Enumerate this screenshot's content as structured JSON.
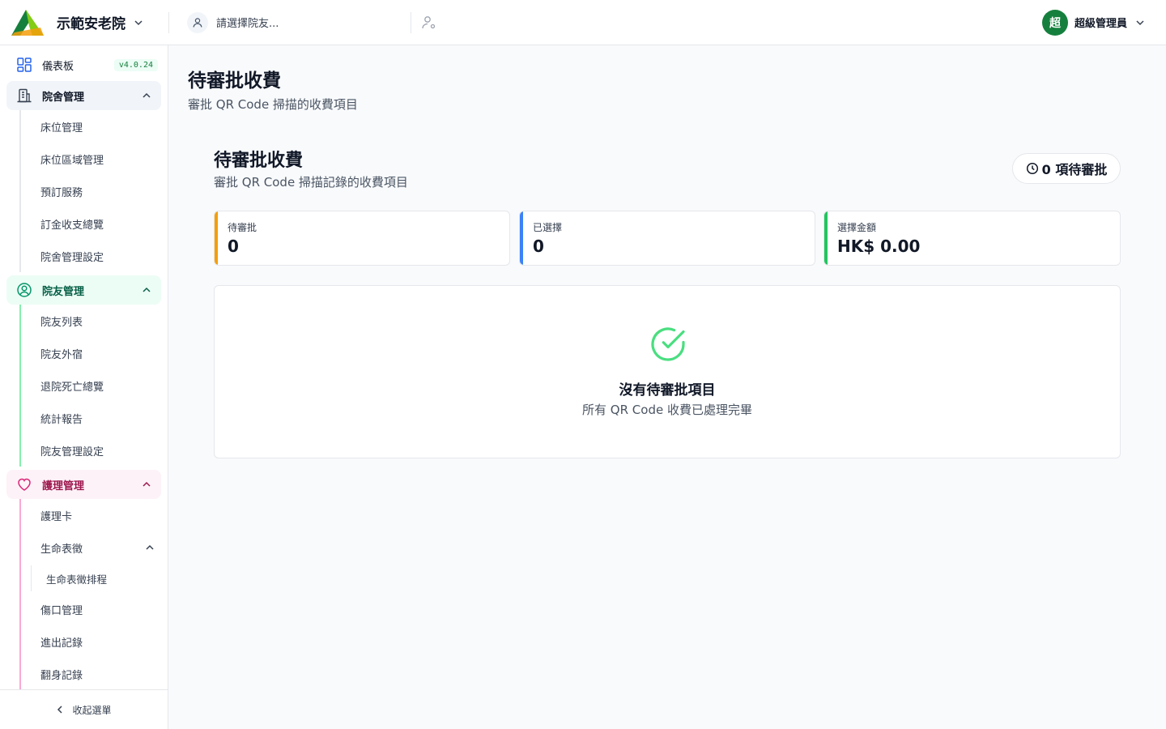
{
  "app": {
    "facility_name": "示範安老院",
    "resident_placeholder": "請選擇院友...",
    "user_initial": "超",
    "user_name": "超級管理員",
    "accent": "#15803d"
  },
  "sidebar": {
    "dashboard": {
      "label": "儀表板",
      "version": "v4.0.24",
      "icon": "dashboard-grid-icon"
    },
    "groups": [
      {
        "label": "院舍管理",
        "icon": "building-icon",
        "items": [
          "床位管理",
          "床位區域管理",
          "預訂服務",
          "訂金收支總覽",
          "院舍管理設定"
        ]
      },
      {
        "label": "院友管理",
        "icon": "user-circle-icon",
        "items": [
          "院友列表",
          "院友外宿",
          "退院死亡總覽",
          "統計報告",
          "院友管理設定"
        ]
      },
      {
        "label": "護理管理",
        "icon": "heart-icon",
        "items": [
          "護理卡",
          "生命表徵",
          "傷口管理",
          "進出記錄",
          "翻身記錄"
        ],
        "nested": {
          "parent": "生命表徵",
          "items": [
            "生命表徵排程"
          ]
        }
      }
    ],
    "collapse_label": "收起選單"
  },
  "main": {
    "page_title": "待審批收費",
    "page_subtitle": "審批 QR Code 掃描的收費項目",
    "section_title": "待審批收費",
    "section_subtitle": "審批 QR Code 掃描記錄的收費項目",
    "pending_pill": "0 項待審批",
    "stats": [
      {
        "label": "待審批",
        "value": "0",
        "color": "#f59e0b"
      },
      {
        "label": "已選擇",
        "value": "0",
        "color": "#3b82f6"
      },
      {
        "label": "選擇金額",
        "value": "HK$ 0.00",
        "color": "#22c55e"
      }
    ],
    "empty": {
      "title": "沒有待審批項目",
      "subtitle": "所有 QR Code 收費已處理完畢",
      "icon": "check-circle-icon"
    }
  }
}
